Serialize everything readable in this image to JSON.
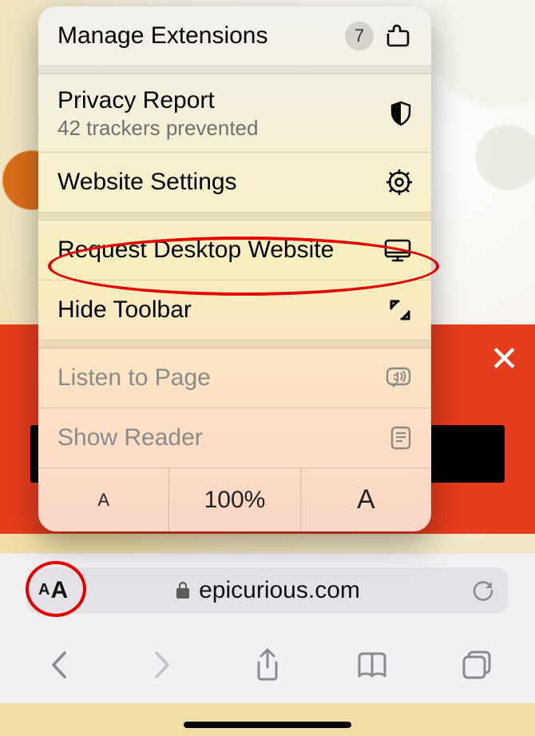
{
  "address_bar": {
    "domain": "epicurious.com"
  },
  "banner": {
    "close_label": "✕"
  },
  "menu": {
    "manage_extensions": {
      "label": "Manage Extensions",
      "badge": "7"
    },
    "privacy_report": {
      "label": "Privacy Report",
      "subtitle": "42 trackers prevented"
    },
    "website_settings": {
      "label": "Website Settings"
    },
    "request_desktop": {
      "label": "Request Desktop Website"
    },
    "hide_toolbar": {
      "label": "Hide Toolbar"
    },
    "listen_to_page": {
      "label": "Listen to Page"
    },
    "show_reader": {
      "label": "Show Reader"
    },
    "text_size": {
      "smaller_glyph": "A",
      "value": "100%",
      "larger_glyph": "A"
    }
  }
}
